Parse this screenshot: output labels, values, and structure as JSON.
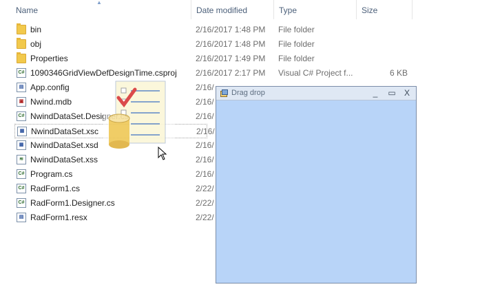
{
  "header": {
    "name": "Name",
    "date_modified": "Date modified",
    "type": "Type",
    "size": "Size"
  },
  "files": [
    {
      "name": "bin",
      "date": "2/16/2017 1:48 PM",
      "type": "File folder",
      "size": "",
      "icon": "folder-icon"
    },
    {
      "name": "obj",
      "date": "2/16/2017 1:48 PM",
      "type": "File folder",
      "size": "",
      "icon": "folder-icon"
    },
    {
      "name": "Properties",
      "date": "2/16/2017 1:49 PM",
      "type": "File folder",
      "size": "",
      "icon": "folder-icon"
    },
    {
      "name": "1090346GridViewDefDesignTime.csproj",
      "date": "2/16/2017 2:17 PM",
      "type": "Visual C# Project f...",
      "size": "6 KB",
      "icon": "csproj-icon"
    },
    {
      "name": "App.config",
      "date": "2/16/",
      "type": "",
      "size": "",
      "icon": "config-icon"
    },
    {
      "name": "Nwind.mdb",
      "date": "2/16/",
      "type": "",
      "size": "",
      "icon": "mdb-icon"
    },
    {
      "name": "NwindDataSet.Designer.cs",
      "date": "2/16/",
      "type": "",
      "size": "",
      "icon": "cs-icon"
    },
    {
      "name": "NwindDataSet.xsc",
      "date": "2/16/",
      "type": "",
      "size": "",
      "icon": "xsc-icon"
    },
    {
      "name": "NwindDataSet.xsd",
      "date": "2/16/",
      "type": "",
      "size": "",
      "icon": "xsd-icon"
    },
    {
      "name": "NwindDataSet.xss",
      "date": "2/16/",
      "type": "",
      "size": "",
      "icon": "xss-icon"
    },
    {
      "name": "Program.cs",
      "date": "2/16/",
      "type": "",
      "size": "",
      "icon": "cs-icon"
    },
    {
      "name": "RadForm1.cs",
      "date": "2/22/",
      "type": "",
      "size": "",
      "icon": "cs-icon"
    },
    {
      "name": "RadForm1.Designer.cs",
      "date": "2/22/",
      "type": "",
      "size": "",
      "icon": "cs-icon"
    },
    {
      "name": "RadForm1.resx",
      "date": "2/22/",
      "type": "",
      "size": "",
      "icon": "resx-icon"
    }
  ],
  "drop_window": {
    "title": "Drag drop",
    "minimize": "_",
    "maximize": "▭",
    "close": "X"
  }
}
